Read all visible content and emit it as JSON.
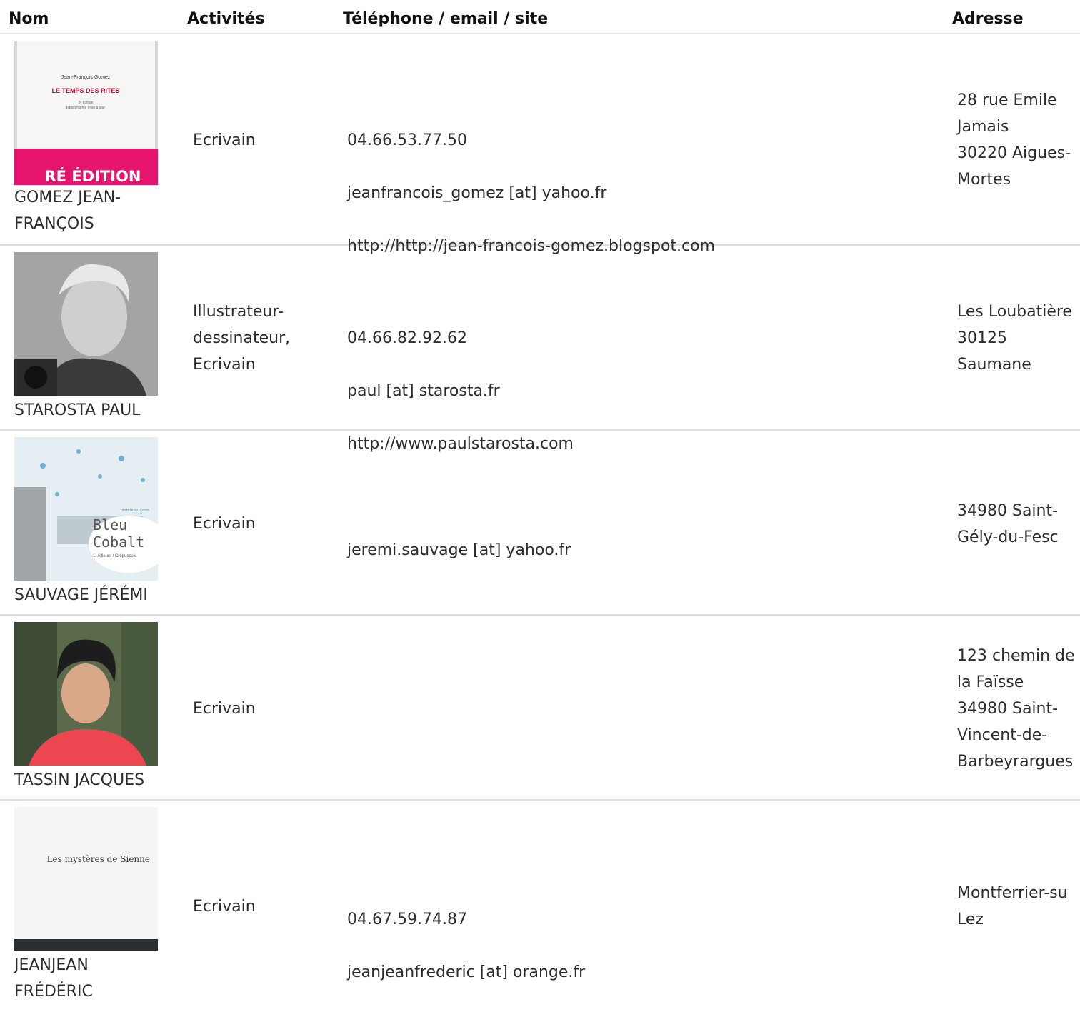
{
  "table": {
    "headers": {
      "nom": "Nom",
      "activites": "Activités",
      "contact": "Téléphone / email / site",
      "adresse": "Adresse"
    },
    "rows": [
      {
        "name": "GOMEZ JEAN-\nFRANÇOIS",
        "photo": "book-cover-le-temps-des-rites",
        "cover_author": "Jean-François Gomez",
        "cover_title": "LE TEMPS DES RITES",
        "cover_sub1": "2ᵉ édition",
        "cover_sub2": "bibliographie mise à jour",
        "cover_band": "RÉ ÉDITION",
        "activities": "Ecrivain",
        "phone": "04.66.53.77.50",
        "email": "jeanfrancois_gomez [at] yahoo.fr",
        "site": "http://http://jean-francois-gomez.blogspot.com",
        "address": "28 rue Emile\nJamais\n30220 Aigues-\nMortes"
      },
      {
        "name": "STAROSTA PAUL",
        "photo": "portrait-photo-bw",
        "activities": "Illustrateur-\ndessinateur,\nEcrivain",
        "phone": "04.66.82.92.62",
        "email": "paul [at] starosta.fr",
        "site": "http://www.paulstarosta.com",
        "address": "Les Loubatière\n30125\nSaumane"
      },
      {
        "name": "SAUVAGE JÉRÉMI",
        "photo": "book-cover-bleu-cobalt",
        "cover_title1": "Bleu",
        "cover_title2": "Cobalt",
        "cover_sub": "1. Ailleurs / Crépuscule",
        "cover_author": "JÉRÉMI SAUVAGE",
        "activities": "Ecrivain",
        "phone": "",
        "email": "jeremi.sauvage [at] yahoo.fr",
        "site": "",
        "address": "34980 Saint-\nGély-du-Fesc"
      },
      {
        "name": "TASSIN JACQUES",
        "photo": "portrait-photo-color",
        "activities": "Ecrivain",
        "phone": "",
        "email": "",
        "site": "",
        "address": "123 chemin de\nla Faïsse\n34980 Saint-\nVincent-de-\nBarbeyrargues"
      },
      {
        "name": "JEANJEAN\nFRÉDÉRIC",
        "photo": "book-cover-les-mysteres-de-sienne",
        "cover_title": "Les mystères de Sienne",
        "activities": "Ecrivain",
        "phone": "04.67.59.74.87",
        "email": "jeanjeanfrederic [at] orange.fr",
        "site": "",
        "address": "Montferrier-su\nLez"
      }
    ]
  }
}
